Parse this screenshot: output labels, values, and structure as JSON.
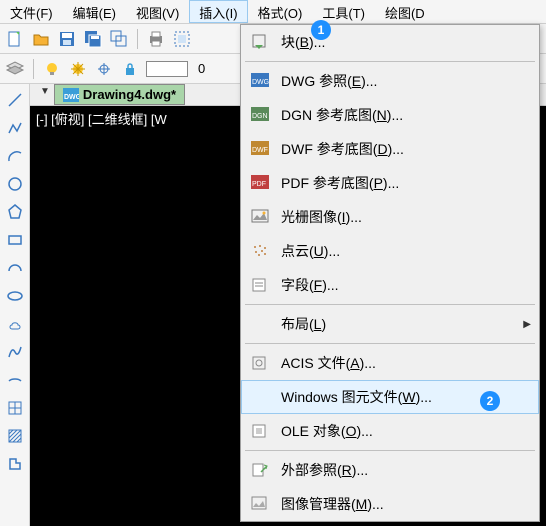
{
  "menu": {
    "file": "文件(F)",
    "edit": "编辑(E)",
    "view": "视图(V)",
    "insert": "插入(I)",
    "format": "格式(O)",
    "tools": "工具(T)",
    "draw": "绘图(D"
  },
  "badges": {
    "b1": "1",
    "b2": "2"
  },
  "tab": {
    "name": "Drawing4.dwg*"
  },
  "canvas": {
    "label": "[-] [俯视] [二维线框] [W"
  },
  "toolbar2": {
    "layer_value": "0"
  },
  "dropdown": {
    "block_pre": "块(",
    "block_key": "B",
    "block_post": ")...",
    "dwg_pre": "DWG 参照(",
    "dwg_key": "E",
    "dwg_post": ")...",
    "dgn_pre": "DGN 参考底图(",
    "dgn_key": "N",
    "dgn_post": ")...",
    "dwf_pre": "DWF 参考底图(",
    "dwf_key": "D",
    "dwf_post": ")...",
    "pdf_pre": "PDF 参考底图(",
    "pdf_key": "P",
    "pdf_post": ")...",
    "raster_pre": "光栅图像(",
    "raster_key": "I",
    "raster_post": ")...",
    "point_pre": "点云(",
    "point_key": "U",
    "point_post": ")...",
    "field_pre": "字段(",
    "field_key": "F",
    "field_post": ")...",
    "layout_pre": "布局(",
    "layout_key": "L",
    "layout_post": ")",
    "acis_pre": "ACIS 文件(",
    "acis_key": "A",
    "acis_post": ")...",
    "wmf_pre": "Windows 图元文件(",
    "wmf_key": "W",
    "wmf_post": ")...",
    "ole_pre": "OLE 对象(",
    "ole_key": "O",
    "ole_post": ")...",
    "xref_pre": "外部参照(",
    "xref_key": "R",
    "xref_post": ")...",
    "imgmgr_pre": "图像管理器(",
    "imgmgr_key": "M",
    "imgmgr_post": ")..."
  }
}
